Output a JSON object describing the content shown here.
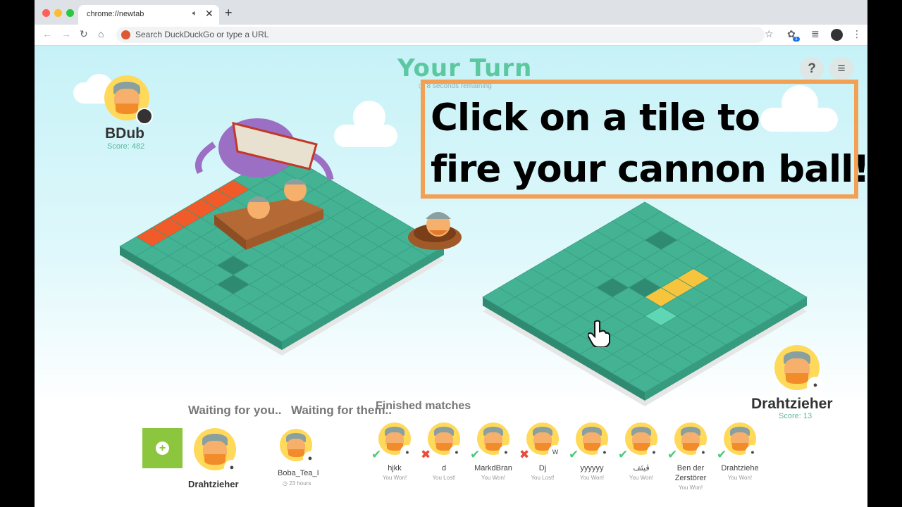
{
  "browser": {
    "tab_title": "chrome://newtab",
    "omnibox_placeholder": "Search DuckDuckGo or type a URL",
    "extension_badge": "1"
  },
  "game": {
    "turn_title": "Your Turn",
    "turn_timer": "8 seconds remaining",
    "help_label": "?",
    "menu_label": "≡",
    "instruction_line1": "Click on a tile to",
    "instruction_line2": "fire your cannon ball!",
    "player1": {
      "name": "BDub",
      "score_label": "Score: 482"
    },
    "player2": {
      "name": "Drahtzieher",
      "score_label": "Score: 13"
    },
    "waiting_you": "Waiting for you..",
    "waiting_them": "Waiting for them..",
    "finished_title": "Finished matches",
    "waiting_you_player": "Drahtzieher",
    "waiting_them_player": {
      "name": "Boba_Tea_I",
      "time": "23 hours"
    },
    "finished": [
      {
        "name": "hjkk",
        "result": "You Won!",
        "mark": "check"
      },
      {
        "name": "d",
        "result": "You Lost!",
        "mark": "cross"
      },
      {
        "name": "MarkdBran",
        "result": "You Won!",
        "mark": "check"
      },
      {
        "name": "Dj",
        "result": "You Lost!",
        "mark": "cross",
        "badge": "W"
      },
      {
        "name": "yyyyyy",
        "result": "You Won!",
        "mark": "check"
      },
      {
        "name": "ڤيتَف",
        "result": "You Won!",
        "mark": "check"
      },
      {
        "name": "Ben der Zerstörer",
        "result": "You Won!",
        "mark": "check"
      },
      {
        "name": "Drahtziehe",
        "result": "You Won!",
        "mark": "check"
      }
    ]
  },
  "colors": {
    "tile": "#3fa88c",
    "tile_top": "#44b394",
    "hit": "#f15a29",
    "selected": "#f7c53d",
    "hover": "#5fd6b4",
    "title": "#5cc8a0",
    "overlay_border": "#f2a154"
  }
}
